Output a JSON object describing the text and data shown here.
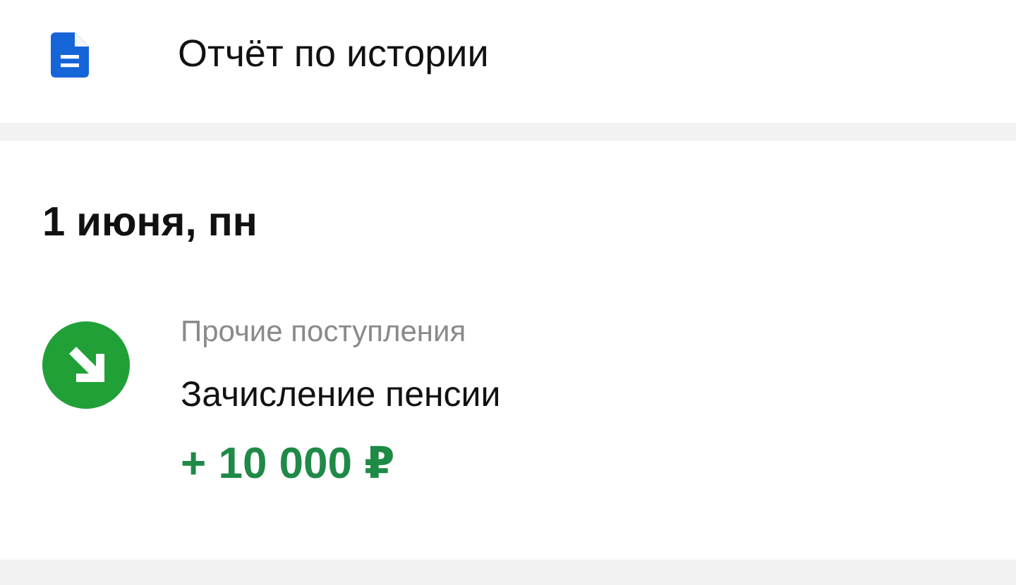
{
  "report_link": {
    "label": "Отчёт по истории"
  },
  "day_groups": [
    {
      "date": "1 июня, пн",
      "transactions": [
        {
          "kind": "income",
          "category": "Прочие поступления",
          "title": "Зачисление пенсии",
          "amount": "+ 10 000 ₽"
        }
      ]
    }
  ]
}
